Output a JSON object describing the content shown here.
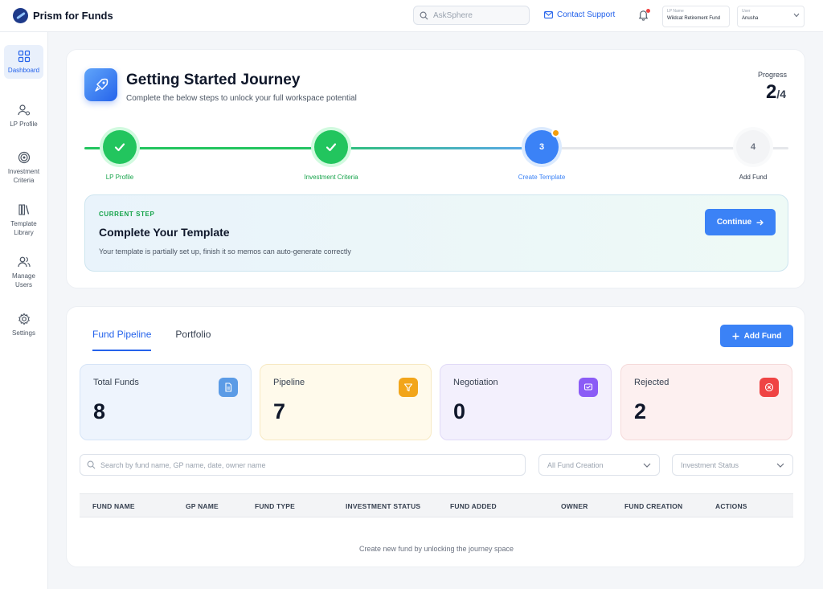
{
  "app": {
    "name": "Prism for Funds"
  },
  "topbar": {
    "search_placeholder": "AskSphere",
    "contact_label": "Contact Support",
    "lp_caption": "LP Name",
    "lp_value": "Wildcat Retirement Fund",
    "user_caption": "User",
    "user_value": "Anusha"
  },
  "sidebar": {
    "items": [
      {
        "label": "Dashboard",
        "icon": "grid-icon",
        "active": true
      },
      {
        "label": "LP Profile",
        "icon": "user-settings-icon"
      },
      {
        "label": "Investment Criteria",
        "icon": "target-icon"
      },
      {
        "label": "Template Library",
        "icon": "library-icon"
      },
      {
        "label": "Manage Users",
        "icon": "users-icon"
      },
      {
        "label": "Settings",
        "icon": "gear-icon"
      }
    ]
  },
  "journey": {
    "title": "Getting Started Journey",
    "subtitle": "Complete the below steps to unlock your full workspace potential",
    "progress_label": "Progress",
    "progress_value": "2",
    "progress_total": "/4",
    "progress_fraction": 0.5,
    "steps": [
      {
        "label": "LP Profile",
        "status": "done",
        "number": "1"
      },
      {
        "label": "Investment Criteria",
        "status": "done",
        "number": "2"
      },
      {
        "label": "Create Template",
        "status": "current",
        "number": "3"
      },
      {
        "label": "Add Fund",
        "status": "todo",
        "number": "4"
      }
    ],
    "current_step": {
      "caption": "CURRENT STEP",
      "title": "Complete Your Template",
      "description": "Your template is partially set up, finish it so memos can auto-generate correctly",
      "button": "Continue"
    }
  },
  "pipeline": {
    "tabs": [
      {
        "label": "Fund Pipeline",
        "active": true
      },
      {
        "label": "Portfolio",
        "active": false
      }
    ],
    "add_button": "Add Fund",
    "stats": [
      {
        "label": "Total Funds",
        "value": "8",
        "icon": "document-icon",
        "color": "#5b9be6"
      },
      {
        "label": "Pipeline",
        "value": "7",
        "icon": "filter-icon",
        "color": "#f2a51a"
      },
      {
        "label": "Negotiation",
        "value": "0",
        "icon": "handshake-icon",
        "color": "#8b5cf6"
      },
      {
        "label": "Rejected",
        "value": "2",
        "icon": "close-circle-icon",
        "color": "#ef4444"
      }
    ],
    "search_placeholder": "Search by fund name, GP name, date, owner name",
    "filter_creation": "All Fund Creation",
    "filter_status": "Investment Status",
    "columns": [
      "FUND NAME",
      "GP NAME",
      "FUND TYPE",
      "INVESTMENT STATUS",
      "FUND ADDED",
      "OWNER",
      "FUND CREATION",
      "ACTIONS"
    ],
    "empty_message": "Create new fund by unlocking the journey space"
  },
  "colors": {
    "accent": "#3b82f6",
    "success": "#22c55e",
    "warning": "#f59e0b"
  }
}
